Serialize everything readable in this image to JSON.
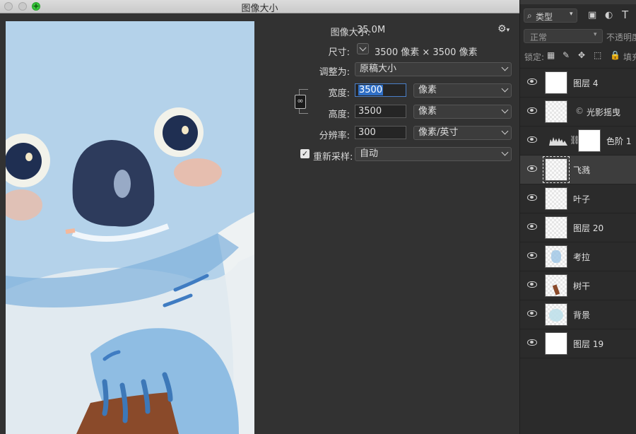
{
  "dialog": {
    "title": "图像大小",
    "image_size_label": "图像大小:",
    "image_size_value": "35.0M",
    "dimensions_label": "尺寸:",
    "dimensions_value": "3500 像素  ×  3500 像素",
    "fit_label": "调整为:",
    "fit_value": "原稿大小",
    "width_label": "宽度:",
    "width_value": "3500",
    "width_unit": "像素",
    "height_label": "高度:",
    "height_value": "3500",
    "height_unit": "像素",
    "resolution_label": "分辨率:",
    "resolution_value": "300",
    "resolution_unit": "像素/英寸",
    "resample_label": "重新采样:",
    "resample_value": "自动",
    "resample_checked": true
  },
  "layers_panel": {
    "kind_filter": "类型",
    "blend_mode": "正常",
    "opacity_label": "不透明度",
    "lock_label": "锁定:",
    "fill_label": "填充",
    "layers": [
      {
        "name": "图层 4",
        "thumb": "white"
      },
      {
        "name": "光影摇曳",
        "thumb": "transparent"
      },
      {
        "name": "色阶 1",
        "thumb": "adjustment"
      },
      {
        "name": "飞溅",
        "thumb": "transparent",
        "selected": true
      },
      {
        "name": "叶子",
        "thumb": "transparent"
      },
      {
        "name": "图层 20",
        "thumb": "transparent"
      },
      {
        "name": "考拉",
        "thumb": "transparent"
      },
      {
        "name": "树干",
        "thumb": "transparent"
      },
      {
        "name": "背景",
        "thumb": "transparent"
      },
      {
        "name": "图层 19",
        "thumb": "white"
      }
    ]
  },
  "colors": {
    "accent": "#2f6fc6",
    "panel_bg": "#2b2b2b",
    "dialog_bg": "#323232"
  }
}
